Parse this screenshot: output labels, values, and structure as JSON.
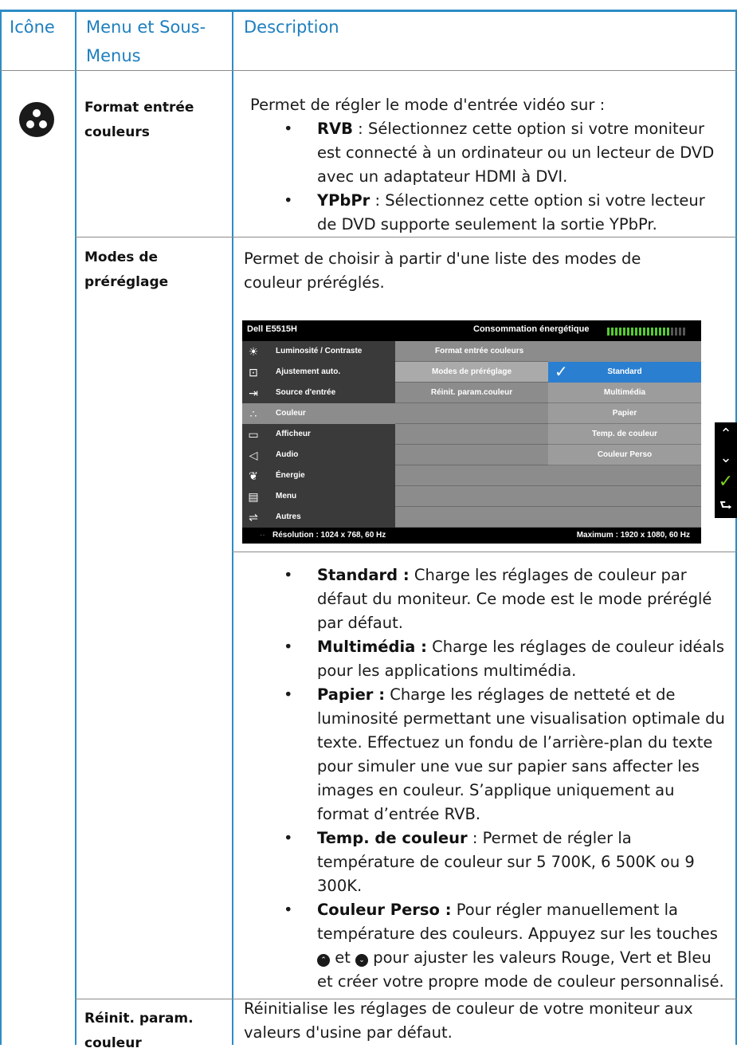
{
  "header": {
    "col1": "Icône",
    "col2": "Menu et Sous-Menus",
    "col3": "Description"
  },
  "rows": {
    "format": {
      "menu": "Format entrée couleurs",
      "intro": "Permet de régler le mode d'entrée vidéo sur :",
      "items": [
        {
          "term": "RVB",
          "text": " : Sélectionnez cette option si votre moniteur est connecté à un ordinateur ou un lecteur de DVD avec un adaptateur HDMI à DVI."
        },
        {
          "term": "YPbPr",
          "text": " : Sélectionnez cette option si votre lecteur de DVD supporte seulement la sortie YPbPr."
        }
      ]
    },
    "presets": {
      "menu": "Modes de préréglage",
      "intro": "Permet de choisir à partir d'une liste des modes de couleur préréglés.",
      "items": [
        {
          "term": "Standard :",
          "text": " Charge les réglages de couleur par défaut du moniteur. Ce mode est le mode préréglé par défaut."
        },
        {
          "term": "Multimédia :",
          "text": "  Charge les réglages de couleur idéals pour les applications multimédia."
        },
        {
          "term": "Papier :",
          "text": " Charge les réglages de netteté et de luminosité permettant une visualisation optimale du texte. Effectuez un fondu de l’arrière-plan du texte pour simuler une vue sur papier sans affecter les images en couleur. S’applique uniquement au format d’entrée RVB."
        },
        {
          "term": "Temp. de couleur",
          "text": " : Permet de régler la température de couleur sur 5 700K, 6 500K ou 9 300K."
        }
      ],
      "custom": {
        "term": "Couleur Perso :",
        "text_a": " Pour régler manuellement la température des couleurs. Appuyez sur les touches ",
        "text_b": " et ",
        "text_c": " pour ajuster les valeurs Rouge, Vert et Bleu et créer votre propre mode de couleur personnalisé."
      }
    },
    "reset": {
      "menu": "Réinit. param. couleur",
      "text": "Réinitialise les réglages de couleur de votre moniteur aux valeurs d'usine par défaut."
    }
  },
  "osd": {
    "title": "Dell E5515H",
    "power_label": "Consommation énergétique",
    "power_level": 0.8,
    "nav": [
      "Luminosité / Contraste",
      "Ajustement auto.",
      "Source d'entrée",
      "Couleur",
      "Afficheur",
      "Audio",
      "Énergie",
      "Menu",
      "Autres"
    ],
    "nav_icons": [
      "brightness-icon",
      "auto-adjust-icon",
      "input-source-icon",
      "color-icon",
      "display-icon",
      "audio-icon",
      "energy-icon",
      "menu-icon",
      "others-icon"
    ],
    "selected_nav": "Couleur",
    "submenu": [
      "Format entrée couleurs",
      "Modes de préréglage",
      "Réinit. param.couleur"
    ],
    "options": [
      "Standard",
      "Multimédia",
      "Papier",
      "Temp. de couleur",
      "Couleur Perso"
    ],
    "selected_option": "Standard",
    "resolution": "Résolution : 1024 x 768, 60 Hz",
    "maximum": "Maximum : 1920 x 1080, 60 Hz"
  },
  "colors": {
    "accent": "#2e8cc4",
    "highlight": "#2b7fd0",
    "power_bar": "#55cc33"
  }
}
